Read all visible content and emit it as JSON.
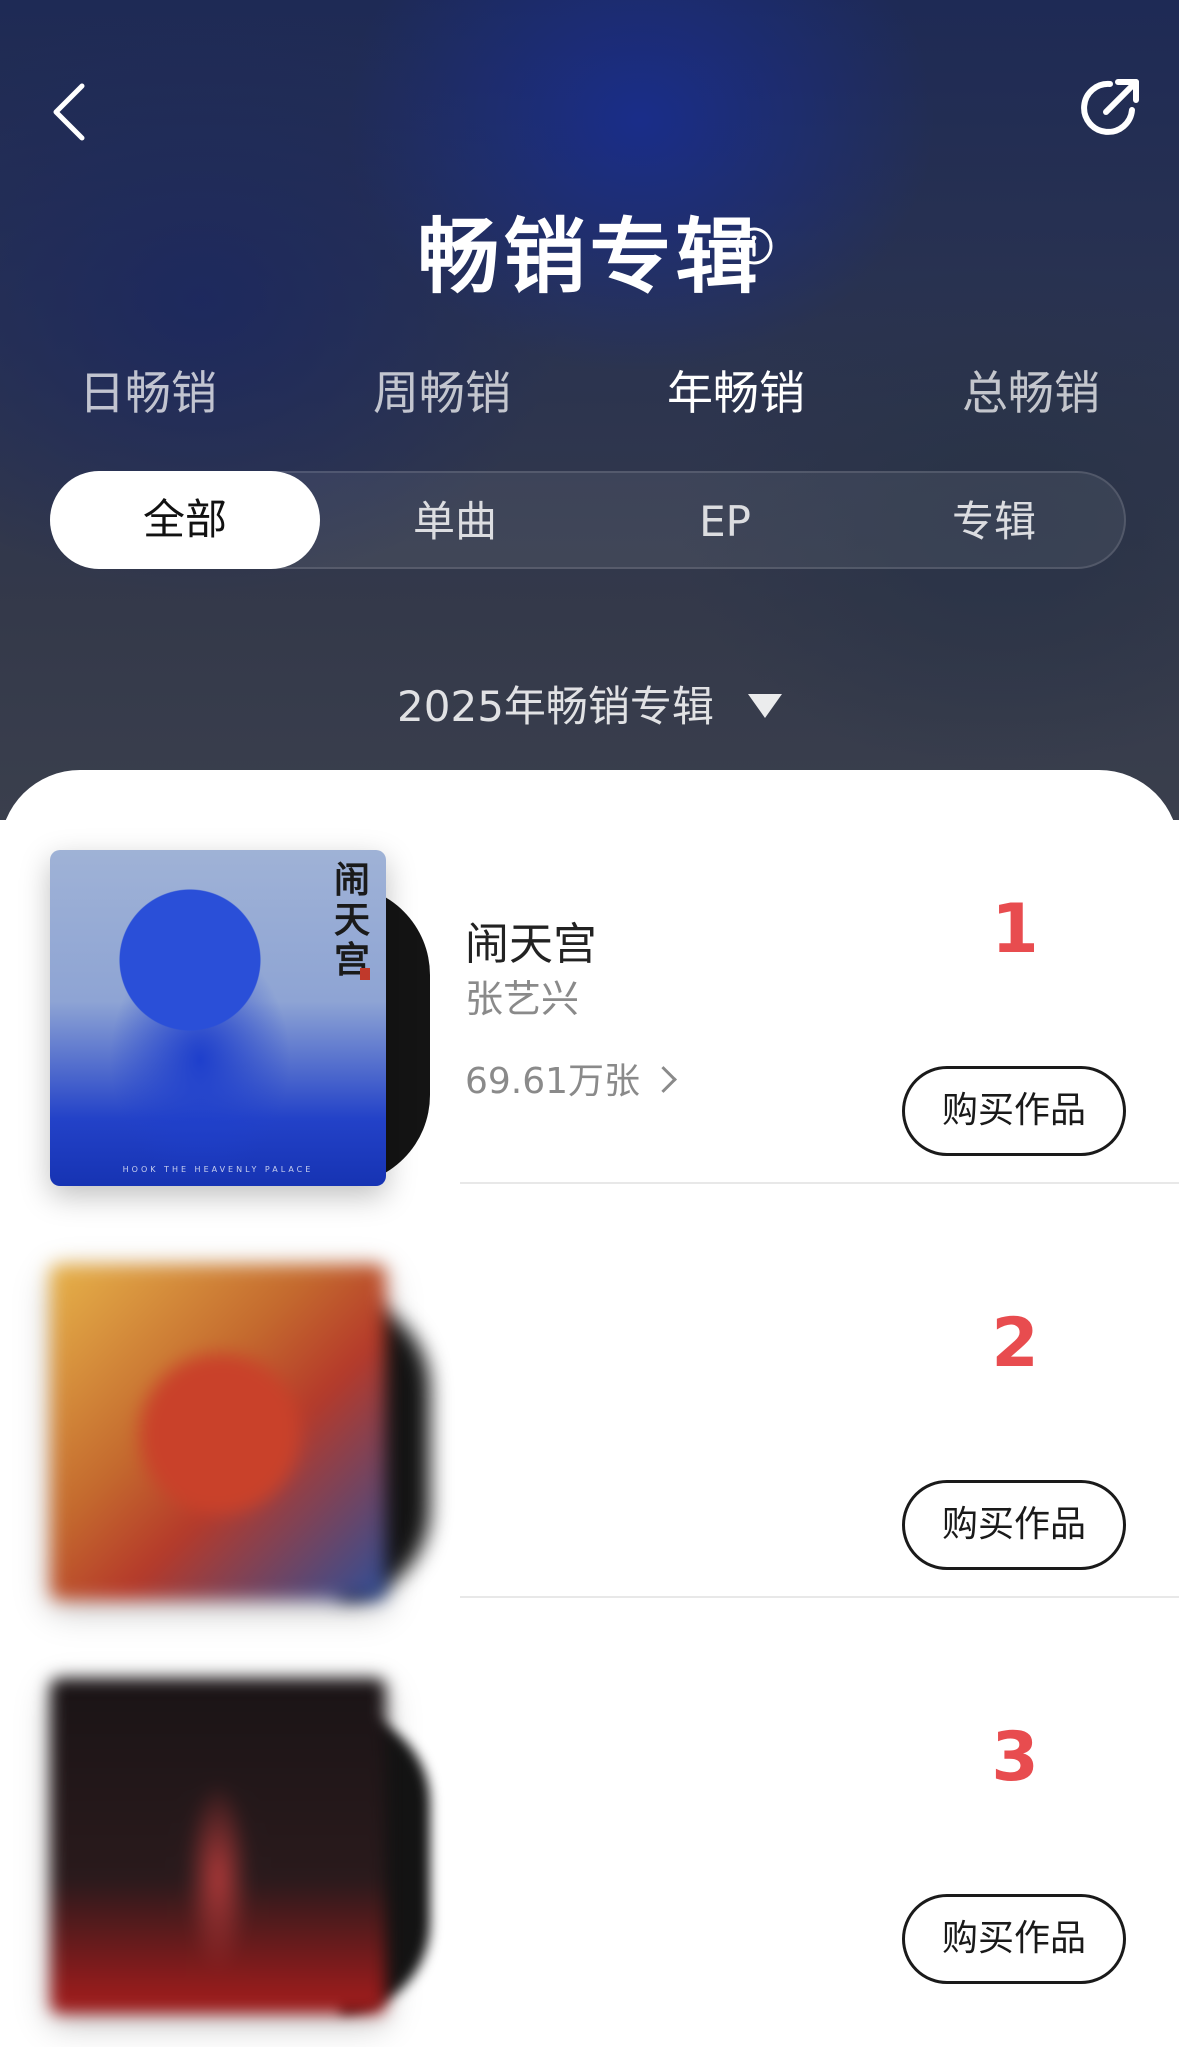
{
  "header": {
    "title": "畅销专辑",
    "back_icon": "chevron-left-icon",
    "share_icon": "share-icon",
    "info_icon": "info-icon"
  },
  "period_tabs": [
    {
      "label": "日畅销",
      "active": false
    },
    {
      "label": "周畅销",
      "active": false
    },
    {
      "label": "年畅销",
      "active": true
    },
    {
      "label": "总畅销",
      "active": false
    }
  ],
  "type_filter": [
    {
      "label": "全部",
      "active": true
    },
    {
      "label": "单曲",
      "active": false
    },
    {
      "label": "EP",
      "active": false
    },
    {
      "label": "专辑",
      "active": false
    }
  ],
  "year_selector": {
    "label": "2025年畅销专辑"
  },
  "albums": [
    {
      "rank": "1",
      "name": "闹天宫",
      "artist": "张艺兴",
      "sales": "69.61万张",
      "buy_label": "购买作品",
      "cover_text": "闹天宫",
      "cover_caption": "HOOK THE HEAVENLY PALACE"
    },
    {
      "rank": "2",
      "name": "",
      "artist": "",
      "sales": "",
      "buy_label": "购买作品"
    },
    {
      "rank": "3",
      "name": "",
      "artist": "",
      "sales": "",
      "buy_label": "购买作品"
    }
  ],
  "colors": {
    "rank": "#e84c4f",
    "accent_text": "#222222",
    "muted_text": "#8a8a8a"
  }
}
